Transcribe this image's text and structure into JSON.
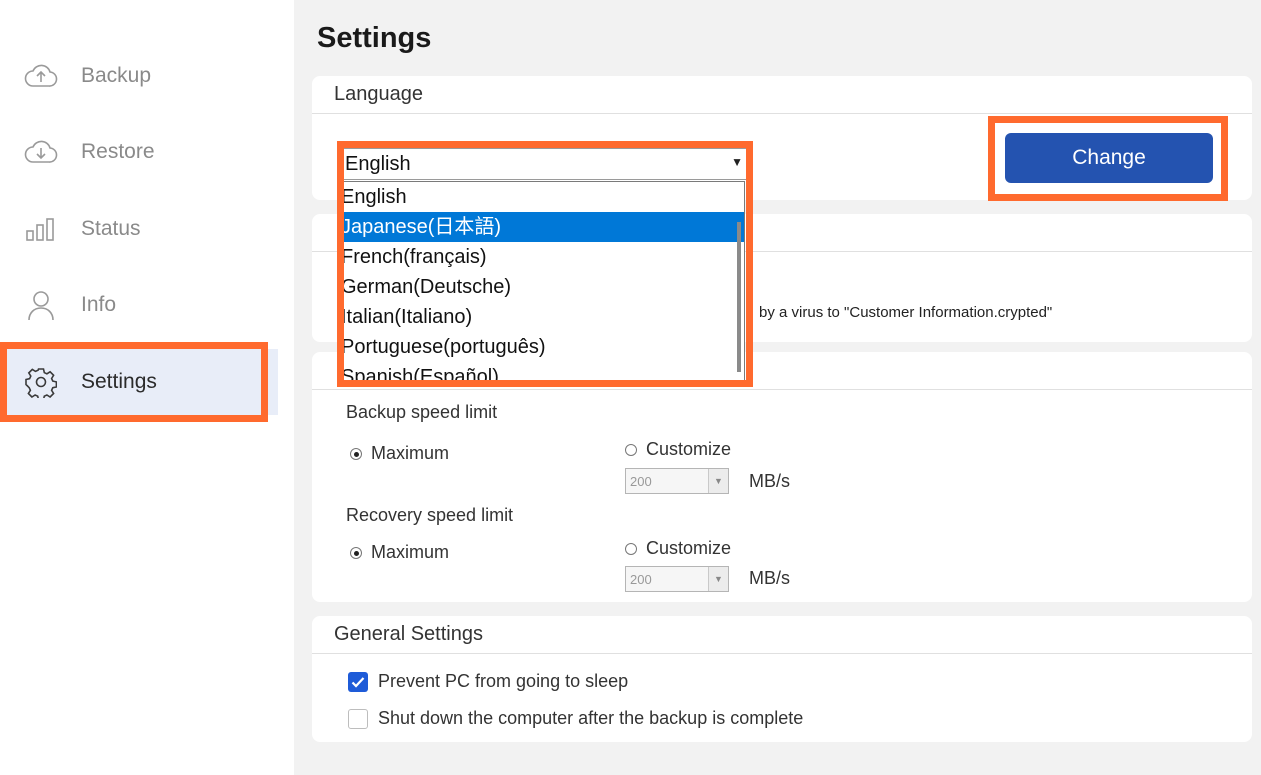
{
  "sidebar": {
    "items": [
      {
        "label": "Backup",
        "icon": "cloud-upload-icon"
      },
      {
        "label": "Restore",
        "icon": "cloud-download-icon"
      },
      {
        "label": "Status",
        "icon": "bar-chart-icon"
      },
      {
        "label": "Info",
        "icon": "user-icon"
      },
      {
        "label": "Settings",
        "icon": "gear-icon",
        "active": true
      }
    ]
  },
  "page": {
    "title": "Settings"
  },
  "language": {
    "header": "Language",
    "selected": "English",
    "options": [
      "English",
      "Japanese(日本語)",
      "French(français)",
      "German(Deutsche)",
      "Italian(Italiano)",
      "Portuguese(português)",
      "Spanish(Español)"
    ],
    "highlighted_option": "Japanese(日本語)",
    "change_label": "Change"
  },
  "ransomware": {
    "text": "by a virus to \"Customer Information.crypted\""
  },
  "speed": {
    "backup_label": "Backup speed limit",
    "recovery_label": "Recovery speed limit",
    "maximum_label": "Maximum",
    "customize_label": "Customize",
    "backup_value": "200",
    "recovery_value": "200",
    "unit": "MB/s"
  },
  "general": {
    "header": "General Settings",
    "prevent_sleep_label": "Prevent PC from going to sleep",
    "prevent_sleep_checked": true,
    "shutdown_label": "Shut down the computer after the backup is complete",
    "shutdown_checked": false
  },
  "colors": {
    "accent": "#2453b0",
    "highlight": "#ff6a2e",
    "selection": "#0078d7"
  }
}
